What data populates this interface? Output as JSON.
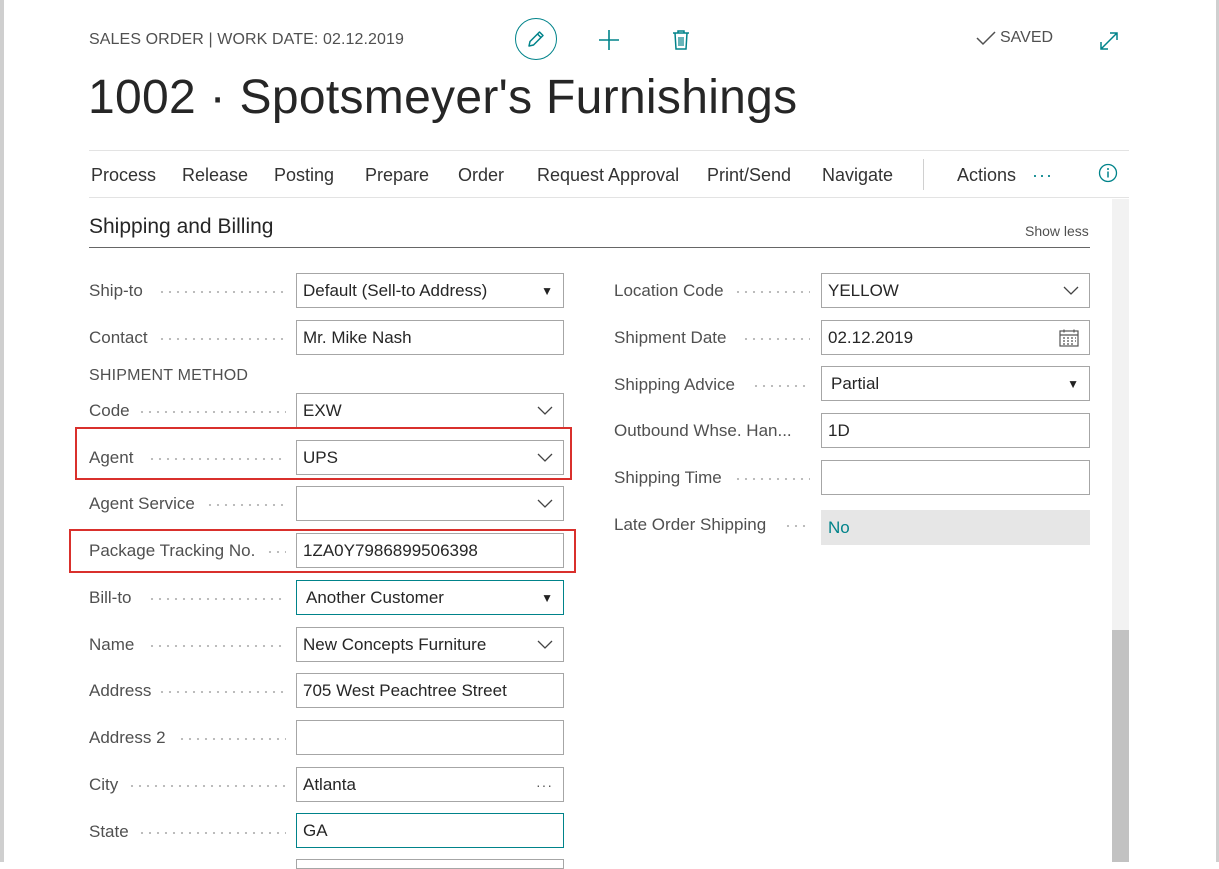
{
  "header": {
    "caption": "SALES ORDER | WORK DATE: 02.12.2019",
    "title": "1002 · Spotsmeyer's Furnishings",
    "saved_label": "SAVED"
  },
  "icons": {
    "edit": "pencil-icon",
    "add": "plus-icon",
    "delete": "trash-icon",
    "saved": "checkmark-icon",
    "expand": "expand-icon",
    "more": "ellipsis-icon",
    "info": "info-icon",
    "dropdown": "chevron-down-icon",
    "select": "caret-down-icon",
    "calendar": "calendar-icon",
    "lookup": "ellipsis-icon"
  },
  "actions": [
    "Process",
    "Release",
    "Posting",
    "Prepare",
    "Order",
    "Request Approval",
    "Print/Send",
    "Navigate",
    "Actions"
  ],
  "section": {
    "title": "Shipping and Billing",
    "toggle": "Show less"
  },
  "left_fields": {
    "ship_to": {
      "label": "Ship-to",
      "value": "Default (Sell-to Address)"
    },
    "contact": {
      "label": "Contact",
      "value": "Mr. Mike Nash"
    },
    "shipment_method_heading": "SHIPMENT METHOD",
    "code": {
      "label": "Code",
      "value": "EXW"
    },
    "agent": {
      "label": "Agent",
      "value": "UPS"
    },
    "agent_service": {
      "label": "Agent Service",
      "value": ""
    },
    "package_tracking": {
      "label": "Package Tracking No.",
      "value": "1ZA0Y7986899506398"
    },
    "bill_to": {
      "label": "Bill-to",
      "value": "Another Customer"
    },
    "name": {
      "label": "Name",
      "value": "New Concepts Furniture"
    },
    "address": {
      "label": "Address",
      "value": "705 West Peachtree Street"
    },
    "address2": {
      "label": "Address 2",
      "value": ""
    },
    "city": {
      "label": "City",
      "value": "Atlanta"
    },
    "state": {
      "label": "State",
      "value": "GA"
    }
  },
  "right_fields": {
    "location_code": {
      "label": "Location Code",
      "value": "YELLOW"
    },
    "shipment_date": {
      "label": "Shipment Date",
      "value": "02.12.2019"
    },
    "shipping_advice": {
      "label": "Shipping Advice",
      "value": "Partial"
    },
    "outbound_whse": {
      "label": "Outbound Whse. Han...",
      "value": "1D"
    },
    "shipping_time": {
      "label": "Shipping Time",
      "value": ""
    },
    "late_order_shipping": {
      "label": "Late Order Shipping",
      "value": "No"
    }
  },
  "colors": {
    "accent": "#00838a",
    "highlight": "#d9302c",
    "readonly_bg": "#e6e6e6"
  }
}
